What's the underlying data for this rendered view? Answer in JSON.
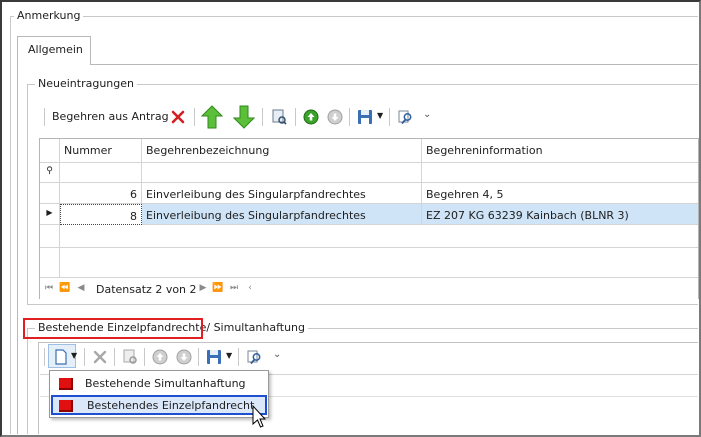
{
  "window": {
    "section_title": "Anmerkung"
  },
  "tabs": [
    {
      "label": "Allgemein"
    }
  ],
  "neueintragungen": {
    "group_title": "Neueintragungen",
    "toolbar": {
      "begehren_label": "Begehren aus Antrag"
    },
    "grid": {
      "columns": [
        "Nummer",
        "Begehrenbezeichnung",
        "Begehreninformation"
      ],
      "filter_icon": "pin-icon",
      "rows": [
        {
          "nummer": "6",
          "bezeichnung": "Einverleibung des Singularpfandrechtes",
          "information": "Begehren 4, 5"
        },
        {
          "nummer": "8",
          "bezeichnung": "Einverleibung des Singularpfandrechtes",
          "information": "EZ 207 KG 63239 Kainbach (BLNR 3)"
        }
      ],
      "selected_row": 2,
      "navigator_text": "Datensatz 2 von 2"
    }
  },
  "bestehende": {
    "group_title_part1": "Bestehende Einzelpfandrechte",
    "group_title_sep": "/",
    "group_title_part2": "Simultanhaftung"
  },
  "dropdown_menu": {
    "items": [
      {
        "label": "Bestehende Simultanhaftung"
      },
      {
        "label": "Bestehendes Einzelpfandrecht"
      }
    ],
    "highlighted_index": 1
  },
  "colors": {
    "accent_green": "#4caf2e",
    "delete_red": "#d42020",
    "selection_blue": "#cfe4f7",
    "highlight_border": "#1f4fd1",
    "callout_red": "#e02020"
  }
}
